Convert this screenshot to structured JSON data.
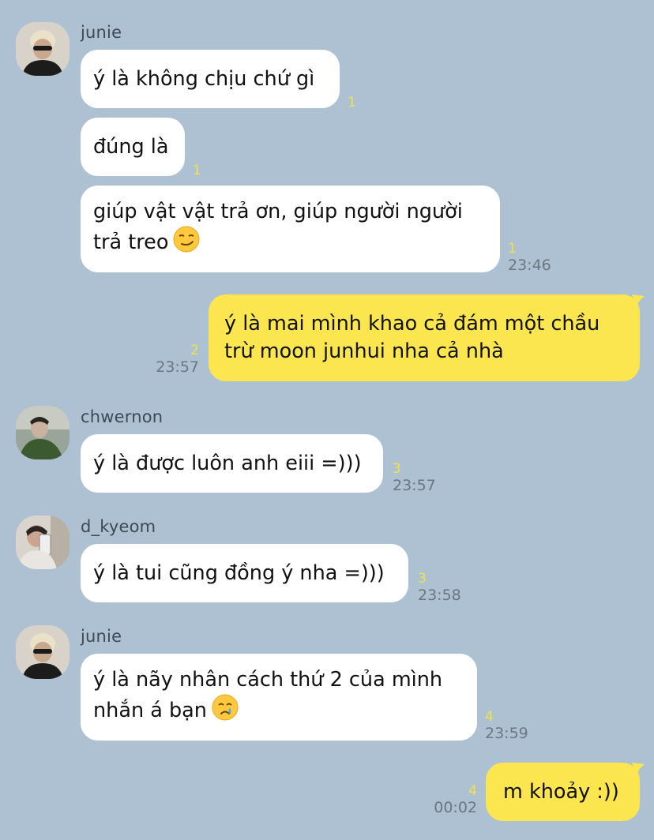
{
  "messages": [
    {
      "sender": "junie",
      "text": "ý là không chịu chứ gì",
      "unread": "1",
      "time": ""
    },
    {
      "text": "đúng là",
      "unread": "1",
      "time": ""
    },
    {
      "text": "giúp vật vật trả ơn, giúp người người\ntrả treo",
      "emoji": "smirk-emoji",
      "unread": "1",
      "time": "23:46"
    },
    {
      "mine": true,
      "text": "ý là mai mình khao cả đám một chầu\ntrừ moon junhui nha cả nhà",
      "unread": "2",
      "time": "23:57"
    },
    {
      "sender": "chwernon",
      "text": "ý là được luôn anh eiii =)))",
      "unread": "3",
      "time": "23:57"
    },
    {
      "sender": "d_kyeom",
      "text": "ý là tui cũng đồng ý nha =)))",
      "unread": "3",
      "time": "23:58"
    },
    {
      "sender": "junie",
      "text": "ý là nãy nhân cách thứ 2 của mình\nnhắn á bạn",
      "emoji": "crying-face-emoji",
      "unread": "4",
      "time": "23:59"
    },
    {
      "mine": true,
      "text": "m khoảy :))",
      "unread": "4",
      "time": "00:02"
    }
  ],
  "colors": {
    "background": "#aec1d3",
    "incoming_bubble": "#ffffff",
    "outgoing_bubble": "#fbe64f",
    "unread_count": "#f0e34a",
    "timestamp": "#6a7783"
  }
}
